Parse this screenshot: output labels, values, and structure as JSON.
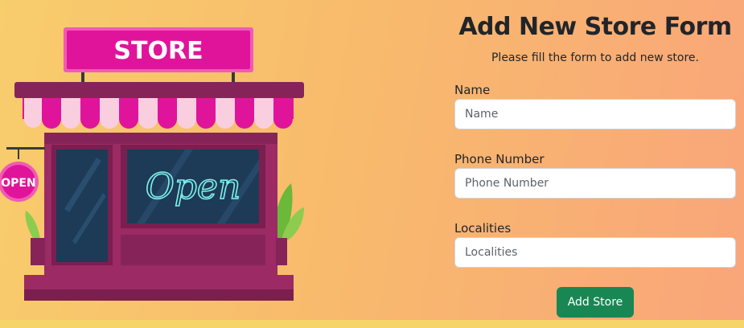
{
  "sign": {
    "text": "STORE"
  },
  "open_badge": {
    "text": "OPEN"
  },
  "window_sign": {
    "text": "Open"
  },
  "form": {
    "title": "Add New Store Form",
    "subtitle": "Please fill the form to add new store.",
    "fields": [
      {
        "label": "Name",
        "placeholder": "Name",
        "value": ""
      },
      {
        "label": "Phone Number",
        "placeholder": "Phone Number",
        "value": ""
      },
      {
        "label": "Localities",
        "placeholder": "Localities",
        "value": ""
      }
    ],
    "submit_label": "Add Store"
  },
  "colors": {
    "primary_button": "#198754",
    "sign_pink": "#e0149a",
    "store_purple": "#9c2a64",
    "window_navy": "#1d3a57",
    "neon": "#7df2e8"
  }
}
